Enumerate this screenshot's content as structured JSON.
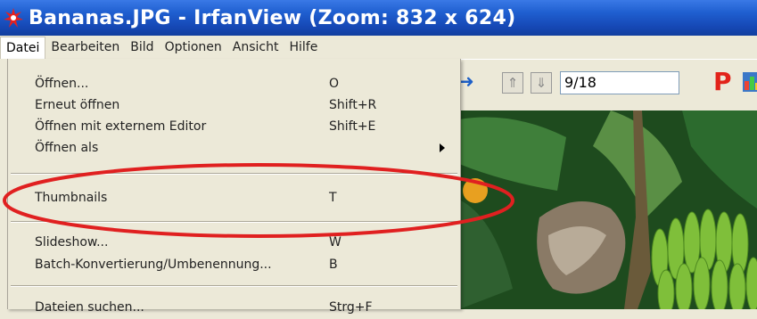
{
  "window": {
    "title": "Bananas.JPG - IrfanView (Zoom: 832 x 624)",
    "app_icon": "irfanview-red-cat-icon"
  },
  "menubar": {
    "items": [
      {
        "label": "Datei",
        "active": true
      },
      {
        "label": "Bearbeiten"
      },
      {
        "label": "Bild"
      },
      {
        "label": "Optionen"
      },
      {
        "label": "Ansicht"
      },
      {
        "label": "Hilfe"
      }
    ]
  },
  "dropdown": {
    "items": [
      {
        "label": "Öffnen...",
        "shortcut": "O"
      },
      {
        "label": "Erneut öffnen",
        "shortcut": "Shift+R"
      },
      {
        "label": "Öffnen mit externem Editor",
        "shortcut": "Shift+E"
      },
      {
        "label": "Öffnen als",
        "shortcut": "",
        "submenu": true
      },
      {
        "label": "Thumbnails",
        "shortcut": "T",
        "circled": true
      },
      {
        "label": "Slideshow...",
        "shortcut": "W"
      },
      {
        "label": "Batch-Konvertierung/Umbenennung...",
        "shortcut": "B"
      },
      {
        "label": "Dateien suchen...",
        "shortcut": "Strg+F"
      }
    ],
    "highlight_color": "#e02020"
  },
  "toolbar": {
    "page_counter": "9/18",
    "icons": [
      "next-arrow-icon",
      "move-up-icon",
      "move-down-icon",
      "print-p-icon",
      "chart-icon"
    ]
  },
  "image": {
    "subject": "bananas-photo"
  }
}
